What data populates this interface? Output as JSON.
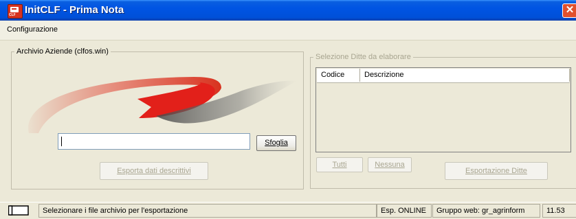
{
  "window": {
    "title": "InitCLF - Prima Nota",
    "close_glyph": "✕",
    "app_icon": "clf-app-icon"
  },
  "menu": {
    "items": [
      "Configurazione"
    ]
  },
  "archive_group": {
    "label": "Archivio Aziende (clfos.win)",
    "path_value": "",
    "browse_button": "Sfoglia",
    "export_descriptive_button": "Esporta dati descrittivi"
  },
  "selection_group": {
    "label": "Selezione Ditte da elaborare",
    "columns": [
      "Codice",
      "Descrizione"
    ],
    "rows": [],
    "all_button": "Tutti",
    "none_button": "Nessuna",
    "export_companies_button": "Esportazione  Ditte"
  },
  "status": {
    "message": "Selezionare i file archivio per l'esportazione",
    "mode": "Esp. ONLINE",
    "web_group": "Gruppo web: gr_agrinform",
    "time": "11.53"
  },
  "colors": {
    "titlebar": "#0054e3",
    "logo_red": "#d8321f",
    "logo_grey": "#4a4a4a",
    "disabled_text": "#a8a590"
  }
}
